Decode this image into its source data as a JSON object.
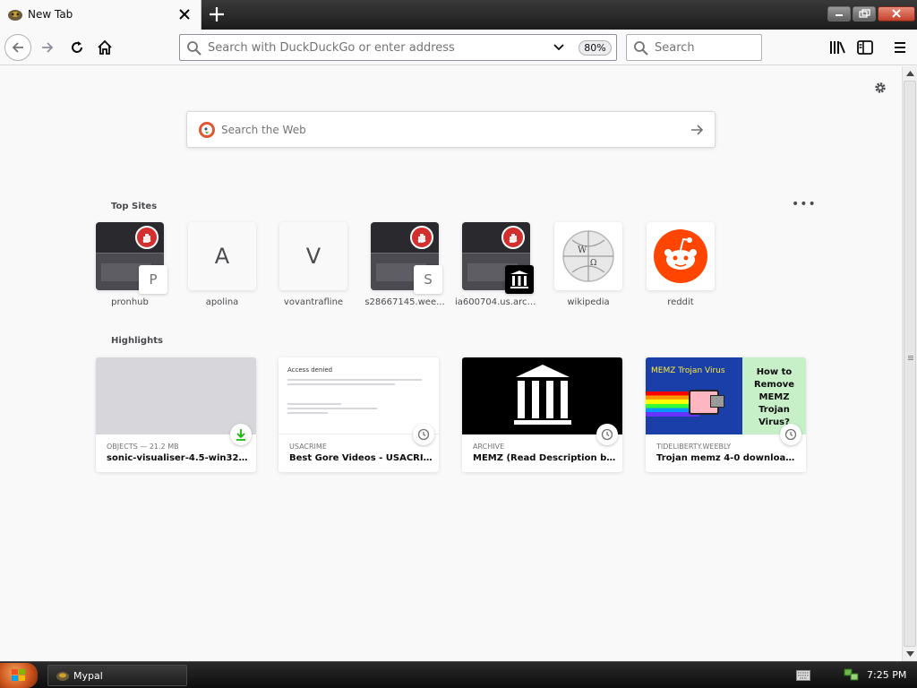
{
  "tab": {
    "title": "New Tab"
  },
  "navbar": {
    "url_placeholder": "Search with DuckDuckGo or enter address",
    "zoom": "80%",
    "search_placeholder": "Search"
  },
  "content": {
    "websearch_placeholder": "Search the Web",
    "top_sites_title": "Top Sites",
    "highlights_title": "Highlights",
    "top_sites": [
      {
        "label": "pronhub",
        "badge": "P"
      },
      {
        "label": "apolina",
        "letter": "A"
      },
      {
        "label": "vovantrafline",
        "letter": "V"
      },
      {
        "label": "s28667145.wee...",
        "badge": "S"
      },
      {
        "label": "ia600704.us.arch..."
      },
      {
        "label": "wikipedia"
      },
      {
        "label": "reddit"
      }
    ],
    "highlights": [
      {
        "source": "OBJECTS — 21.2 MB",
        "title": "sonic-visualiser-4.5-win32(2)...."
      },
      {
        "source": "USACRIME",
        "title": "Best Gore Videos - USACRIME",
        "thumb_heading": "Access denied"
      },
      {
        "source": "ARCHIVE",
        "title": "MEMZ (Read Description befo..."
      },
      {
        "source": "TIDELIBERTY.WEEBLY",
        "title": "Trojan memz 4-0 download - t...",
        "thumb_left": "MEMZ Trojan Virus",
        "thumb_right": "How to Remove MEMZ Trojan Virus?"
      }
    ]
  },
  "taskbar": {
    "task_label": "Mypal",
    "clock": "7:25 PM"
  }
}
